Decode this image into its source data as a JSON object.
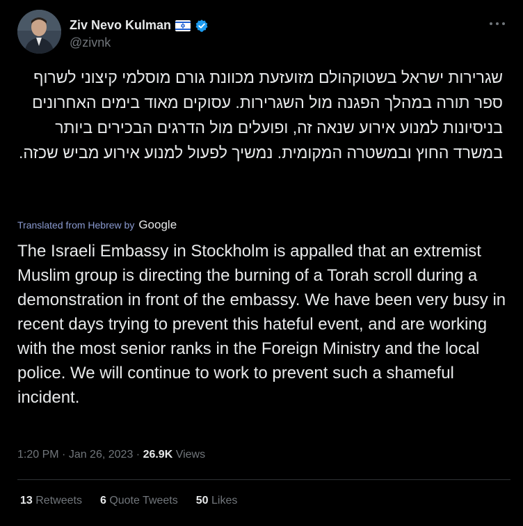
{
  "author": {
    "name": "Ziv Nevo Kulman",
    "handle": "@zivnk",
    "flag_icon": "israel-flag-icon",
    "verified_icon": "verified-badge-icon",
    "verified_color": "#1d9bf0"
  },
  "tweet": {
    "hebrew_text": "שגרירות ישראל בשטוקהולם מזועזעת מכוונת גורם מוסלמי קיצוני לשרוף ספר תורה במהלך הפגנה מול השגרירות. עסוקים מאוד בימים האחרונים בניסיונות למנוע אירוע שנאה זה, ופועלים מול הדרגים הבכירים ביותר במשרד החוץ ובמשטרה המקומית. נמשיך לפעול למנוע אירוע מביש שכזה.",
    "translated_label": "Translated from Hebrew by",
    "translated_provider": "Google",
    "english_text": "The Israeli Embassy in Stockholm is appalled that an extremist Muslim group is directing the burning of a Torah scroll during a demonstration in front of the embassy. We have been very busy in recent days trying to prevent this hateful event, and are working with the most senior ranks in the Foreign Ministry and the local police. We will continue to work to prevent such a shameful incident."
  },
  "meta": {
    "time": "1:20 PM",
    "separator": " · ",
    "date": "Jan 26, 2023",
    "views_count": "26.9K",
    "views_label": "Views"
  },
  "stats": {
    "retweets_count": "13",
    "retweets_label": "Retweets",
    "quotes_count": "6",
    "quotes_label": "Quote Tweets",
    "likes_count": "50",
    "likes_label": "Likes"
  },
  "colors": {
    "background": "#000000",
    "text": "#e7e9ea",
    "muted": "#71767b",
    "link": "#8a9ad0",
    "accent": "#1d9bf0"
  }
}
